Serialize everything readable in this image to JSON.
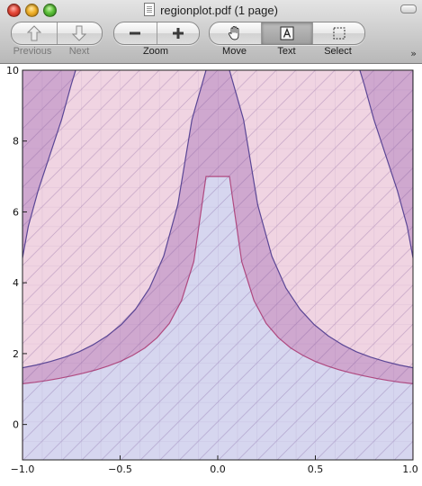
{
  "window": {
    "title": "regionplot.pdf (1 page)"
  },
  "toolbar": {
    "previous_label": "Previous",
    "next_label": "Next",
    "zoom_label": "Zoom",
    "move_label": "Move",
    "text_label": "Text",
    "select_label": "Select",
    "overflow_glyph": "»",
    "active_tool": "Text",
    "icons": {
      "previous": "up-arrow-icon",
      "next": "down-arrow-icon",
      "zoom_out": "minus-icon",
      "zoom_in": "plus-icon",
      "move": "hand-icon",
      "text": "text-cursor-icon",
      "select": "marquee-icon"
    }
  },
  "chart_data": {
    "type": "area",
    "title": "",
    "xlabel": "",
    "ylabel": "",
    "xlim": [
      -1.0,
      1.0
    ],
    "ylim": [
      -1.0,
      10.0
    ],
    "x_ticks": [
      "-1.0",
      "-0.5",
      "0.0",
      "0.5",
      "1.0"
    ],
    "y_ticks": [
      "0",
      "2",
      "4",
      "6",
      "8",
      "10"
    ],
    "colors": {
      "outer_region": "#f0d4e2",
      "lower_region": "#d6d6ef",
      "band_region": "#cfa8cf",
      "band_edge": "#5b4796",
      "lower_edge": "#b04a80"
    },
    "regions": [
      {
        "name": "",
        "description_curve": "lower",
        "boundary_y": [
          1.15,
          1.19,
          1.24,
          1.3,
          1.37,
          1.45,
          1.54,
          1.65,
          1.78,
          1.95,
          2.16,
          2.45,
          2.85,
          3.5,
          4.6,
          7.0
        ]
      },
      {
        "name": "",
        "description_curve": "band-upper",
        "boundary_y": [
          1.6,
          1.68,
          1.78,
          1.9,
          2.05,
          2.25,
          2.5,
          2.82,
          3.25,
          3.85,
          4.75,
          6.2,
          8.6,
          10.0
        ]
      }
    ]
  }
}
